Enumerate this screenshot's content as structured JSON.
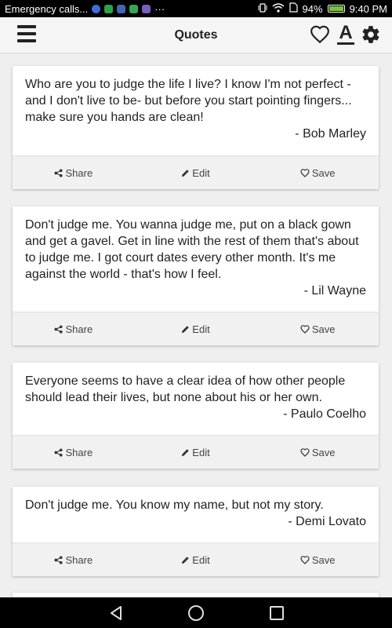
{
  "status_bar": {
    "carrier_text": "Emergency calls...",
    "more": "···",
    "battery": "94%",
    "time": "9:40 PM",
    "notification_colors": [
      "#3b6fd6",
      "#2aa34a",
      "#4267b2",
      "#34a853",
      "#7b5cc4"
    ],
    "battery_level": 0.94
  },
  "app_bar": {
    "title": "Quotes",
    "font_icon_glyph": "A"
  },
  "quotes": [
    {
      "text": "Who are you to judge the life I live? I know I'm not perfect - and I don't live to be- but before you start pointing fingers... make sure you hands are clean!",
      "author": "- Bob Marley"
    },
    {
      "text": "Don't judge me. You wanna judge me, put on a black gown and get a gavel. Get in line with the rest of them that's about to judge me. I got court dates every other month. It's me against the world - that's how I feel.",
      "author": "- Lil Wayne"
    },
    {
      "text": "Everyone seems to have a clear idea of how other people should lead their lives, but none about his or her own.",
      "author": "- Paulo Coelho"
    },
    {
      "text": "Don't judge me. You know my name, but not my story.",
      "author": "- Demi Lovato"
    }
  ],
  "actions": {
    "share": "Share",
    "edit": "Edit",
    "save": "Save"
  }
}
